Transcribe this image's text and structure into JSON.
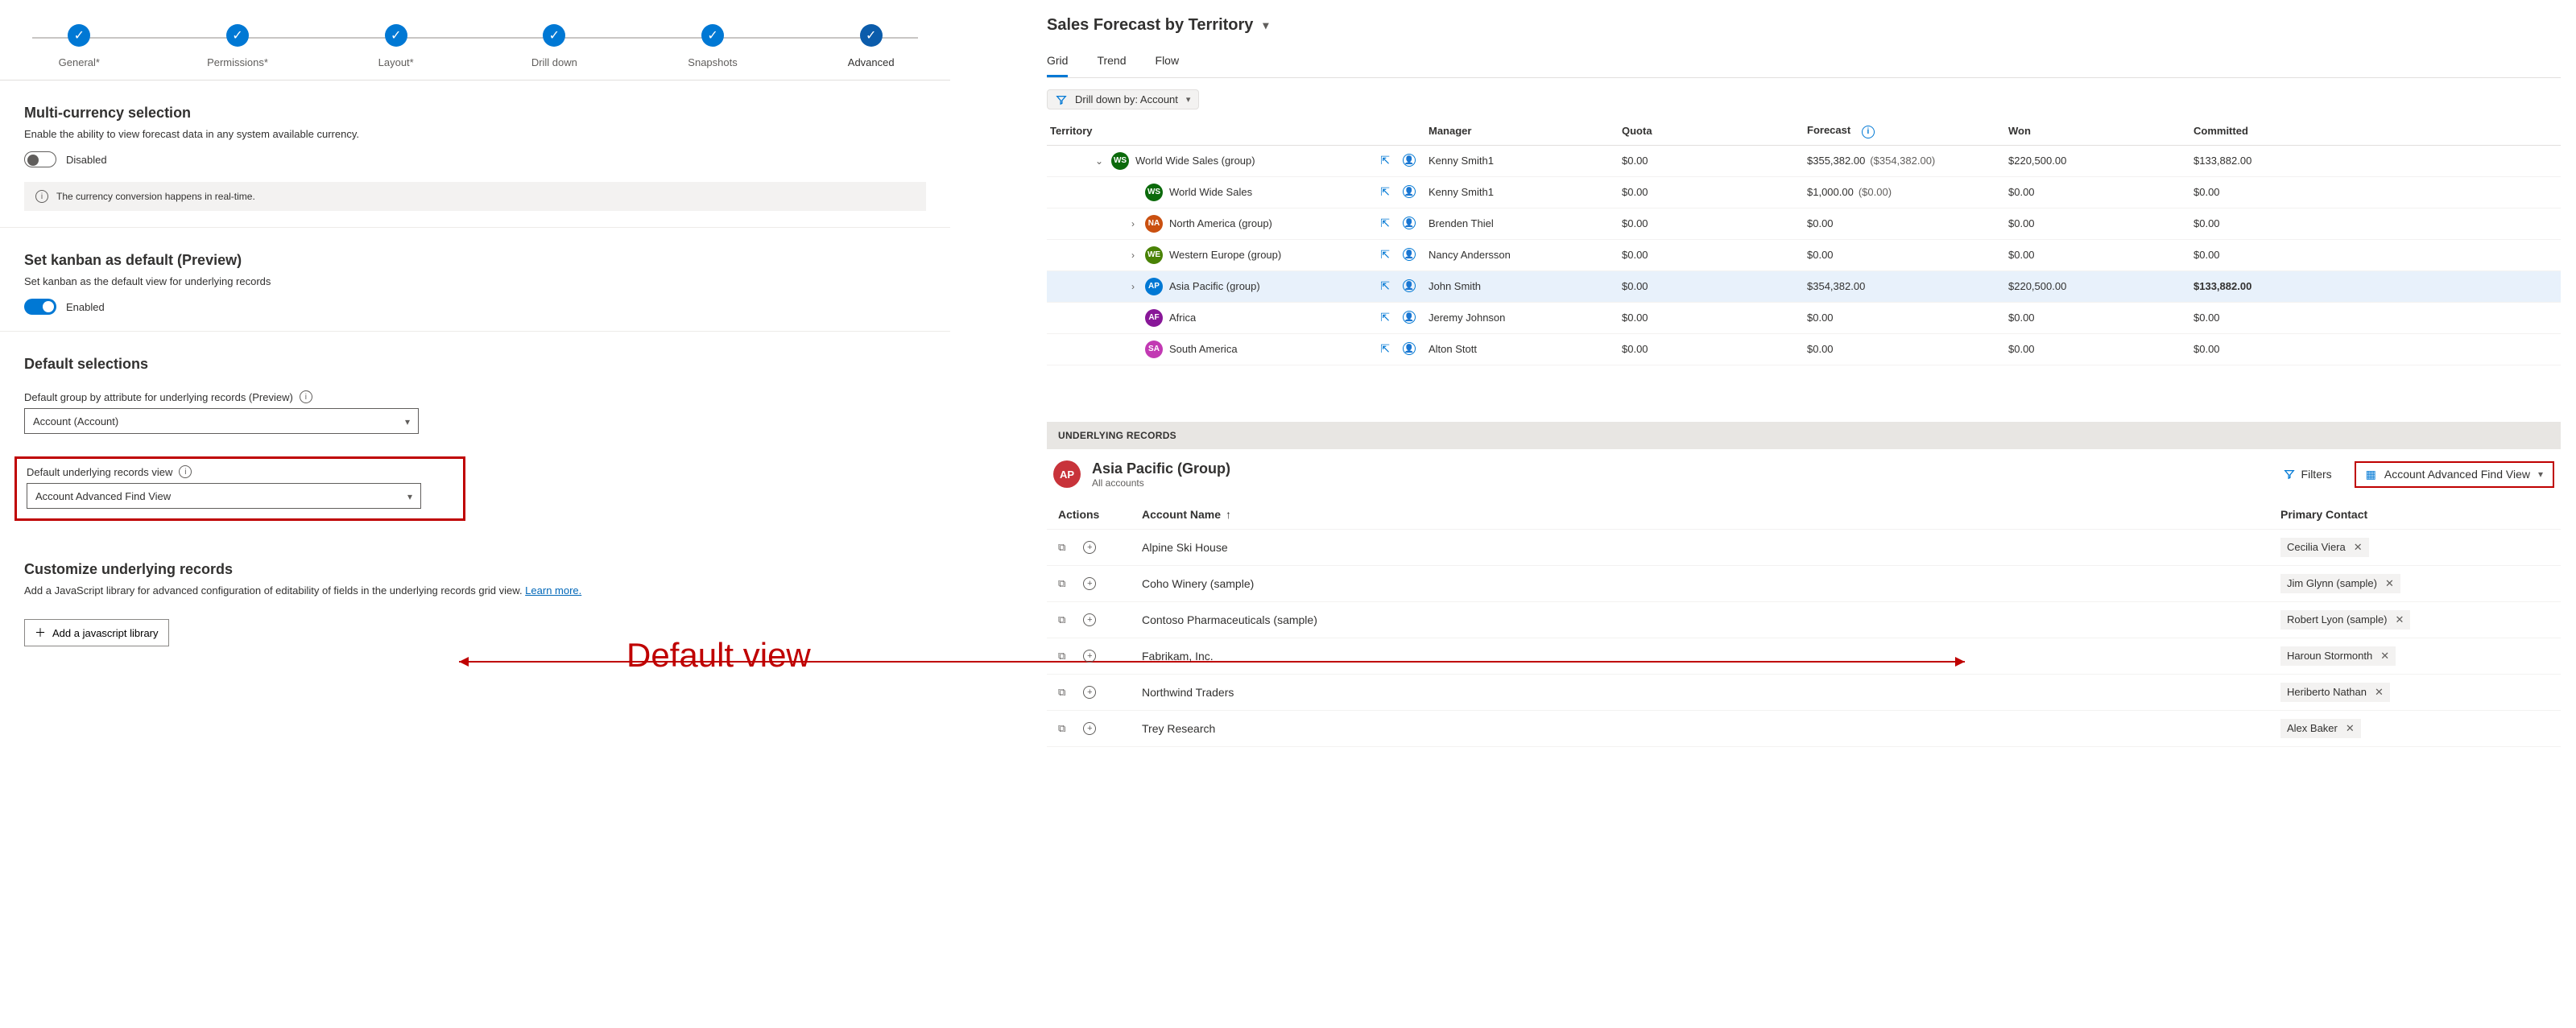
{
  "steps": [
    {
      "label": "General*"
    },
    {
      "label": "Permissions*"
    },
    {
      "label": "Layout*"
    },
    {
      "label": "Drill down"
    },
    {
      "label": "Snapshots"
    },
    {
      "label": "Advanced"
    }
  ],
  "multicurrency": {
    "title": "Multi-currency selection",
    "desc": "Enable the ability to view forecast data in any system available currency.",
    "state": "Disabled",
    "info": "The currency conversion happens in real-time."
  },
  "kanban": {
    "title": "Set kanban as default (Preview)",
    "desc": "Set kanban as the default view for underlying records",
    "state": "Enabled"
  },
  "defaults": {
    "title": "Default selections",
    "group_label": "Default group by attribute for underlying records (Preview)",
    "group_value": "Account (Account)",
    "view_label": "Default underlying records view",
    "view_value": "Account Advanced Find View"
  },
  "customize": {
    "title": "Customize underlying records",
    "desc_a": "Add a JavaScript library for advanced configuration of editability of fields in the underlying records grid view. ",
    "learn": "Learn more.",
    "btn": "Add a javascript library"
  },
  "annotation": "Default view",
  "forecast": {
    "title": "Sales Forecast by Territory",
    "tabs": [
      "Grid",
      "Trend",
      "Flow"
    ],
    "drilldown": "Drill down by: Account",
    "headers": {
      "territory": "Territory",
      "manager": "Manager",
      "quota": "Quota",
      "forecast": "Forecast",
      "won": "Won",
      "committed": "Committed"
    },
    "rows": [
      {
        "indent": 1,
        "expand": "open",
        "avClass": "ws",
        "init": "WS",
        "name": "World Wide Sales (group)",
        "mgr": "Kenny Smith1",
        "quota": "$0.00",
        "forecast": "$355,382.00",
        "forecast2": "($354,382.00)",
        "won": "$220,500.00",
        "comm": "$133,882.00",
        "sel": false
      },
      {
        "indent": 2,
        "expand": "",
        "avClass": "ws",
        "init": "WS",
        "name": "World Wide Sales",
        "mgr": "Kenny Smith1",
        "quota": "$0.00",
        "forecast": "$1,000.00",
        "forecast2": "($0.00)",
        "won": "$0.00",
        "comm": "$0.00",
        "sel": false
      },
      {
        "indent": 2,
        "expand": "closed",
        "avClass": "na",
        "init": "NA",
        "name": "North America (group)",
        "mgr": "Brenden Thiel",
        "quota": "$0.00",
        "forecast": "$0.00",
        "forecast2": "",
        "won": "$0.00",
        "comm": "$0.00",
        "sel": false
      },
      {
        "indent": 2,
        "expand": "closed",
        "avClass": "we",
        "init": "WE",
        "name": "Western Europe (group)",
        "mgr": "Nancy Andersson",
        "quota": "$0.00",
        "forecast": "$0.00",
        "forecast2": "",
        "won": "$0.00",
        "comm": "$0.00",
        "sel": false
      },
      {
        "indent": 2,
        "expand": "closed",
        "avClass": "ap",
        "init": "AP",
        "name": "Asia Pacific (group)",
        "mgr": "John Smith",
        "quota": "$0.00",
        "forecast": "$354,382.00",
        "forecast2": "",
        "won": "$220,500.00",
        "comm": "$133,882.00",
        "sel": true
      },
      {
        "indent": 2,
        "expand": "",
        "avClass": "af",
        "init": "AF",
        "name": "Africa",
        "mgr": "Jeremy Johnson",
        "quota": "$0.00",
        "forecast": "$0.00",
        "forecast2": "",
        "won": "$0.00",
        "comm": "$0.00",
        "sel": false
      },
      {
        "indent": 2,
        "expand": "",
        "avClass": "sa",
        "init": "SA",
        "name": "South America",
        "mgr": "Alton Stott",
        "quota": "$0.00",
        "forecast": "$0.00",
        "forecast2": "",
        "won": "$0.00",
        "comm": "$0.00",
        "sel": false
      }
    ]
  },
  "underlying": {
    "bar": "UNDERLYING RECORDS",
    "avatar": "AP",
    "title": "Asia Pacific (Group)",
    "sub": "All accounts",
    "filters": "Filters",
    "view": "Account Advanced Find View",
    "headers": {
      "actions": "Actions",
      "name": "Account Name",
      "contact": "Primary Contact"
    },
    "rows": [
      {
        "name": "Alpine Ski House",
        "contact": "Cecilia Viera"
      },
      {
        "name": "Coho Winery (sample)",
        "contact": "Jim Glynn (sample)"
      },
      {
        "name": "Contoso Pharmaceuticals (sample)",
        "contact": "Robert Lyon (sample)"
      },
      {
        "name": "Fabrikam, Inc.",
        "contact": "Haroun Stormonth"
      },
      {
        "name": "Northwind Traders",
        "contact": "Heriberto Nathan"
      },
      {
        "name": "Trey Research",
        "contact": "Alex Baker"
      }
    ]
  }
}
